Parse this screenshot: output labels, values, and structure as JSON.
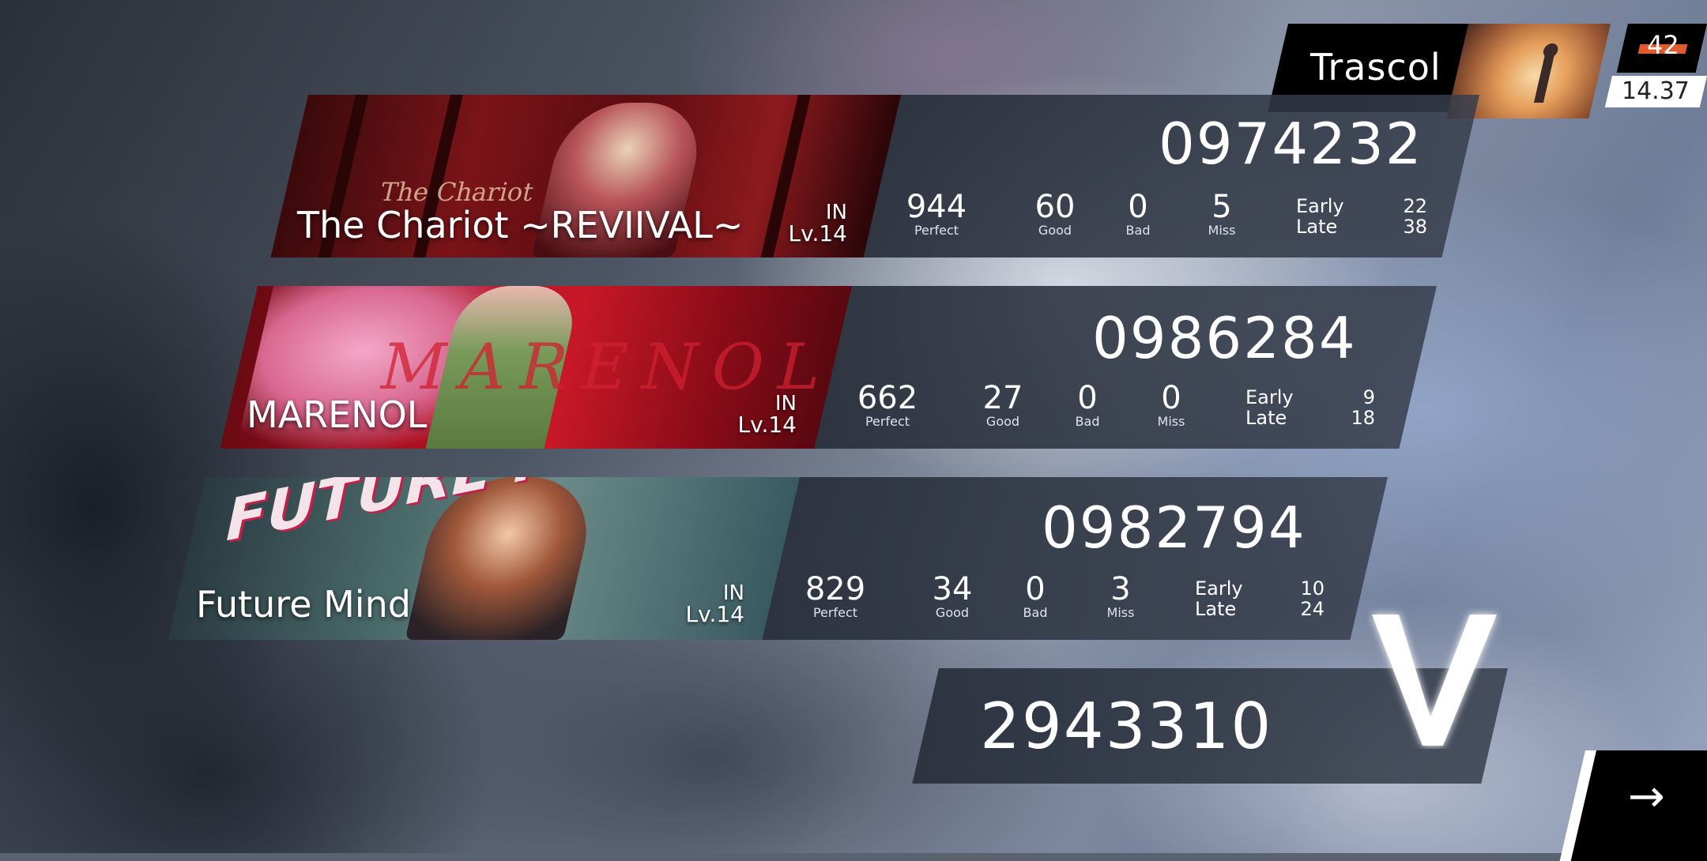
{
  "player": {
    "name": "Trascol",
    "rks_level": "42",
    "rks_value": "14.37"
  },
  "songs": [
    {
      "title": "The Chariot ~REVIIVAL~",
      "art_text": "The Chariot",
      "difficulty": "IN",
      "level": "Lv.14",
      "score": "0974232",
      "perfect": "944",
      "good": "60",
      "bad": "0",
      "miss": "5",
      "early": "22",
      "late": "38"
    },
    {
      "title": "MARENOL",
      "art_text": "MARENOL",
      "difficulty": "IN",
      "level": "Lv.14",
      "score": "0986284",
      "perfect": "662",
      "good": "27",
      "bad": "0",
      "miss": "0",
      "early": "9",
      "late": "18"
    },
    {
      "title": "Future Mind",
      "art_text": "FUTURE MIND",
      "difficulty": "IN",
      "level": "Lv.14",
      "score": "0982794",
      "perfect": "829",
      "good": "34",
      "bad": "0",
      "miss": "3",
      "early": "10",
      "late": "24"
    }
  ],
  "labels": {
    "perfect": "Perfect",
    "good": "Good",
    "bad": "Bad",
    "miss": "Miss",
    "early": "Early",
    "late": "Late"
  },
  "total": {
    "score": "2943310",
    "rank": "V"
  },
  "next_button": {
    "icon": "arrow-right-icon",
    "glyph": "→"
  },
  "colors": {
    "rks_accent": "#e05a2b",
    "chariot_art": "#7a1418",
    "marenol_art": "#a81020",
    "future_art": "#4a6a6a"
  }
}
